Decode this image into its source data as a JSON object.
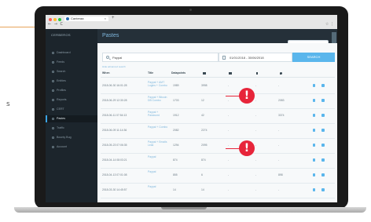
{
  "browser": {
    "tab_title": "Canteraa",
    "tab_close": "×",
    "new_tab": "+",
    "nav_glyphs": "← → C",
    "menu_glyphs": "☆ ⋮"
  },
  "sidebar": {
    "brand": "CERBEROS",
    "items": [
      {
        "label": "Dashboard",
        "icon": "dashboard-icon"
      },
      {
        "label": "Feeds",
        "icon": "feeds-icon"
      },
      {
        "label": "Search",
        "icon": "search-icon"
      },
      {
        "label": "Entities",
        "icon": "entities-icon"
      },
      {
        "label": "Profiles",
        "icon": "profiles-icon"
      },
      {
        "label": "Reports",
        "icon": "reports-icon"
      },
      {
        "label": "CERT",
        "icon": "cert-icon"
      },
      {
        "label": "Pastes",
        "icon": "pastes-icon"
      },
      {
        "label": "Traffic",
        "icon": "traffic-icon"
      },
      {
        "label": "Bounty Bug",
        "icon": "bug-icon"
      },
      {
        "label": "Account",
        "icon": "account-icon"
      }
    ]
  },
  "header": {
    "page_title": "Pastes",
    "top_button": "+ NEW PASTE ALERT"
  },
  "filters": {
    "search_value": "Paypal",
    "date_range": "01/01/2018 - 30/06/2018",
    "search_button": "SEARCH",
    "advanced_link": "Hide advanced search"
  },
  "table": {
    "headers": [
      "When",
      "Title",
      "Datapoints"
    ],
    "rows": [
      {
        "when": "2018-06-30 16:01:28",
        "title": "Paypal + AMT Logins + Combo",
        "datapoints": "1989",
        "c1": "3998",
        "c2": "-",
        "c3": "-",
        "c4": "-"
      },
      {
        "when": "2018-06-29 12:30:28",
        "title": "Paypal + Bitcoin DB Combo",
        "datapoints": "1703",
        "c1": "12",
        "c2": "-",
        "c3": "-",
        "c4": "2083"
      },
      {
        "when": "2018-06-11 07:54:13",
        "title": "Paypal + Password",
        "datapoints": "1912",
        "c1": "42",
        "c2": "-",
        "c3": "-",
        "c4": "3374"
      },
      {
        "when": "2018-06-09 11:14:36",
        "title": "Paypal + Combo",
        "datapoints": "2082",
        "c1": "2274",
        "c2": "-",
        "c3": "-",
        "c4": "-"
      },
      {
        "when": "2018-05-23 07:06:35",
        "title": "Paypal + Emails Leak",
        "datapoints": "1294",
        "c1": "2095",
        "c2": "-",
        "c3": "-",
        "c4": "-"
      },
      {
        "when": "2018-04-14 08:03:21",
        "title": "Paypal",
        "datapoints": "874",
        "c1": "874",
        "c2": "-",
        "c3": "-",
        "c4": "-"
      },
      {
        "when": "2018-04-13 07:01:08",
        "title": "Paypal",
        "datapoints": "855",
        "c1": "6",
        "c2": "-",
        "c3": "-",
        "c4": "898"
      },
      {
        "when": "2018-03-30 14:45:57",
        "title": "Paypal",
        "datapoints": "14",
        "c1": "14",
        "c2": "-",
        "c3": "-",
        "c4": "-"
      }
    ]
  },
  "alerts": {
    "mark": "!"
  },
  "page": {
    "side_glyph": "s"
  },
  "colors": {
    "accent": "#5ab6ec",
    "sidebar": "#1c252c",
    "alert": "#e7253a"
  }
}
